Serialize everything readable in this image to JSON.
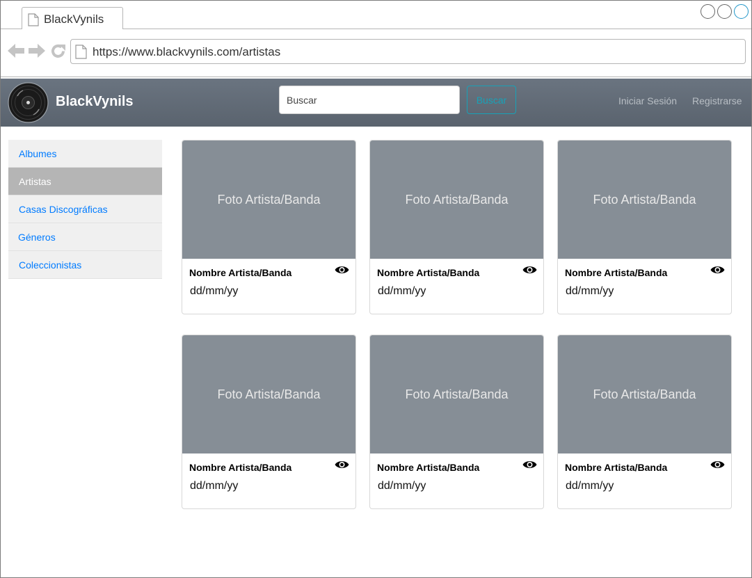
{
  "browser": {
    "tab_title": "BlackVynils",
    "url": "https://www.blackvynils.com/artistas"
  },
  "navbar": {
    "brand": "BlackVynils",
    "search_placeholder": "Buscar",
    "search_button": "Buscar",
    "login": "Iniciar Sesión",
    "register": "Registrarse"
  },
  "sidebar": {
    "items": [
      {
        "label": "Albumes",
        "active": false
      },
      {
        "label": "Artistas",
        "active": true
      },
      {
        "label": "Casas Discográficas",
        "active": false
      },
      {
        "label": "Géneros",
        "active": false
      },
      {
        "label": "Coleccionistas",
        "active": false
      }
    ]
  },
  "cards": [
    {
      "image_label": "Foto Artista/Banda",
      "title": "Nombre Artista/Banda",
      "date": "dd/mm/yy"
    },
    {
      "image_label": "Foto Artista/Banda",
      "title": "Nombre Artista/Banda",
      "date": "dd/mm/yy"
    },
    {
      "image_label": "Foto Artista/Banda",
      "title": "Nombre Artista/Banda",
      "date": "dd/mm/yy"
    },
    {
      "image_label": "Foto Artista/Banda",
      "title": "Nombre Artista/Banda",
      "date": "dd/mm/yy"
    },
    {
      "image_label": "Foto Artista/Banda",
      "title": "Nombre Artista/Banda",
      "date": "dd/mm/yy"
    },
    {
      "image_label": "Foto Artista/Banda",
      "title": "Nombre Artista/Banda",
      "date": "dd/mm/yy"
    }
  ],
  "icons": {
    "back": "arrow-left-icon",
    "forward": "arrow-right-icon",
    "reload": "reload-icon",
    "page": "page-icon",
    "logo": "vinyl-record-icon",
    "view": "eye-icon"
  },
  "colors": {
    "navbar": "#5f6873",
    "accent_button": "#17a2b8",
    "link": "#007bff",
    "active_item": "#b5b5b5",
    "placeholder_image": "#868e96"
  }
}
